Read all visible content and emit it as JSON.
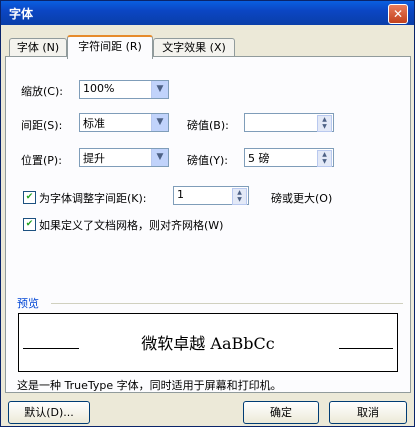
{
  "window": {
    "title": "字体",
    "close_glyph": "✕"
  },
  "tabs": [
    {
      "label": "字体 (N)"
    },
    {
      "label": "字符间距 (R)"
    },
    {
      "label": "文字效果 (X)"
    }
  ],
  "spacing": {
    "scale_label": "缩放(C):",
    "scale_value": "100%",
    "spacing_label": "间距(S):",
    "spacing_value": "标准",
    "spacing_by_label": "磅值(B):",
    "spacing_by_value": "",
    "position_label": "位置(P):",
    "position_value": "提升",
    "position_by_label": "磅值(Y):",
    "position_by_value": "5 磅",
    "kerning_label": "为字体调整字间距(K):",
    "kerning_value": "1",
    "kerning_suffix": "磅或更大(O)",
    "kerning_checked": true,
    "grid_label": "如果定义了文档网格，则对齐网格(W)",
    "grid_checked": true
  },
  "preview": {
    "section_label": "预览",
    "sample_text": "微软卓越 AaBbCc",
    "footnote": "这是一种 TrueType 字体，同时适用于屏幕和打印机。"
  },
  "buttons": {
    "default": "默认(D)...",
    "ok": "确定",
    "cancel": "取消"
  },
  "icons": {
    "dropdown": "▼",
    "spin_up": "▲",
    "spin_down": "▼",
    "check": "✔"
  }
}
